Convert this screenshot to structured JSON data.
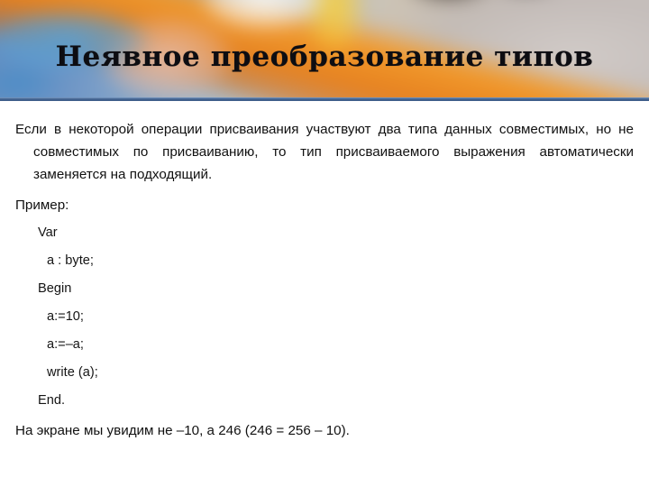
{
  "slide": {
    "title": "Неявное преобразование типов",
    "accent_color": "#41628f",
    "background_color": "#ffffff",
    "text_color": "#111111",
    "banner": {
      "description_icon": "chalk-photo-banner",
      "colors": {
        "blue": "#5d89be",
        "orange": "#e87e18",
        "yellow": "#f7ce3d",
        "white_chalk": "#f8f6f2",
        "grey": "#d1cbc8"
      }
    },
    "body": {
      "paragraph": "Если в некоторой операции присваивания участвуют два типа данных совместимых, но не совместимых по присваиванию, то тип присваиваемого выражения автоматически заменяется на подходящий.",
      "example_label": "Пример:",
      "code": [
        {
          "text": "Var",
          "indent": 1
        },
        {
          "text": "a : byte;",
          "indent": 2
        },
        {
          "text": "Begin",
          "indent": 1
        },
        {
          "text": "a:=10;",
          "indent": 2
        },
        {
          "text": "a:=–a;",
          "indent": 2
        },
        {
          "text": "write (a);",
          "indent": 2
        },
        {
          "text": "End.",
          "indent": 1
        }
      ],
      "conclusion": "На экране мы увидим не –10, а 246 (246 = 256 – 10)."
    }
  }
}
